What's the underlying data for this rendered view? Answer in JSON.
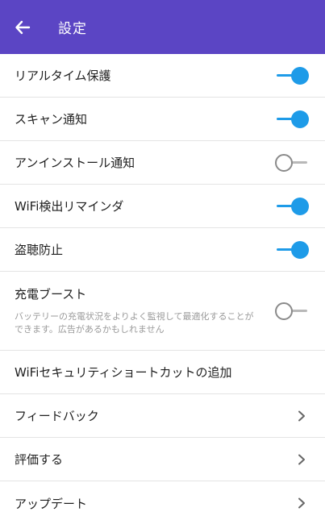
{
  "appbar": {
    "title": "設定"
  },
  "colors": {
    "appbar": "#5b45c4",
    "toggle_on": "#1e9be8",
    "toggle_off": "#8a8a8a"
  },
  "settings": [
    {
      "label": "リアルタイム保護",
      "type": "toggle",
      "on": true
    },
    {
      "label": "スキャン通知",
      "type": "toggle",
      "on": true
    },
    {
      "label": "アンインストール通知",
      "type": "toggle",
      "on": false
    },
    {
      "label": "WiFi検出リマインダ",
      "type": "toggle",
      "on": true
    },
    {
      "label": "盗聴防止",
      "type": "toggle",
      "on": true
    },
    {
      "label": "充電ブースト",
      "desc": "バッテリーの充電状況をよりよく監視して最適化することができます。広告があるかもしれません",
      "type": "toggle",
      "on": false
    },
    {
      "label": "WiFiセキュリティショートカットの追加",
      "type": "plain"
    },
    {
      "label": "フィードバック",
      "type": "nav"
    },
    {
      "label": "評価する",
      "type": "nav"
    },
    {
      "label": "アップデート",
      "type": "nav"
    }
  ]
}
